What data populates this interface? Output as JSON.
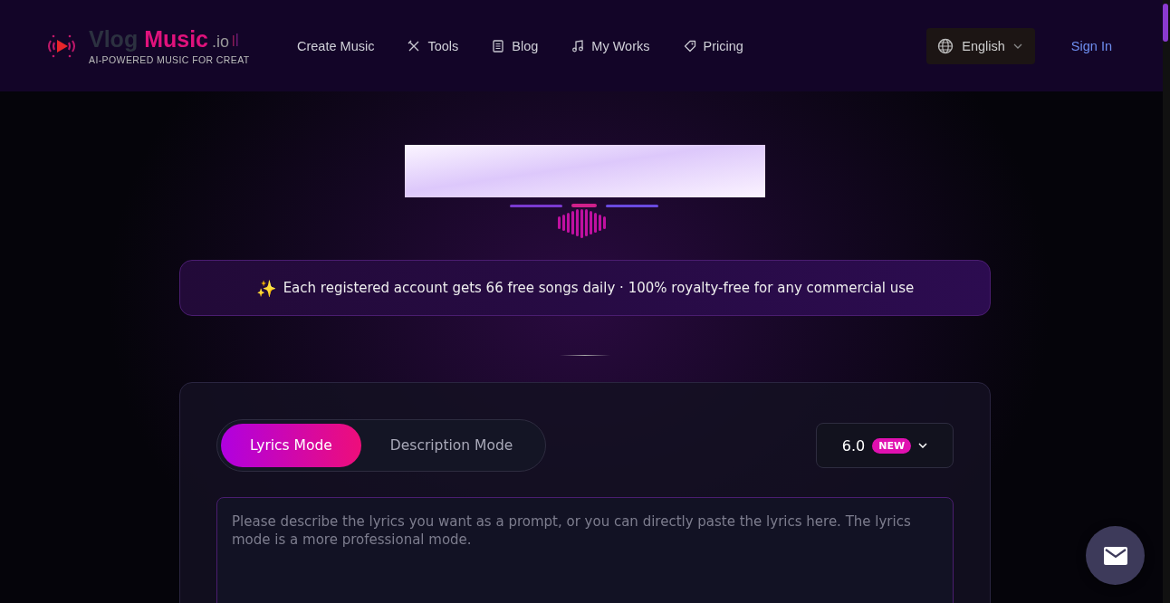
{
  "header": {
    "logo": {
      "word_1": "Vlog",
      "word_2": "Music",
      "suffix": ".io",
      "tagline": "AI-POWERED MUSIC FOR CREAT"
    },
    "nav": [
      {
        "label": "Create Music",
        "kind": "plain"
      },
      {
        "label": "Tools",
        "kind": "tools"
      },
      {
        "label": "Blog",
        "kind": "blog"
      },
      {
        "label": "My Works",
        "kind": "works"
      },
      {
        "label": "Pricing",
        "kind": "pricing"
      }
    ],
    "language": "English",
    "sign_in": "Sign In"
  },
  "notice": {
    "icon": "✨",
    "text": "Each registered account gets 66 free songs daily · 100% royalty-free for any commercial use"
  },
  "composer": {
    "modes": [
      {
        "label": "Lyrics Mode",
        "selected": true
      },
      {
        "label": "Description Mode",
        "selected": false
      }
    ],
    "version": {
      "label": "6.0",
      "badge": "NEW"
    },
    "prompt": {
      "placeholder": "Please describe the lyrics you want as a prompt, or you can directly paste the lyrics here. The lyrics mode is a more professional mode."
    }
  }
}
